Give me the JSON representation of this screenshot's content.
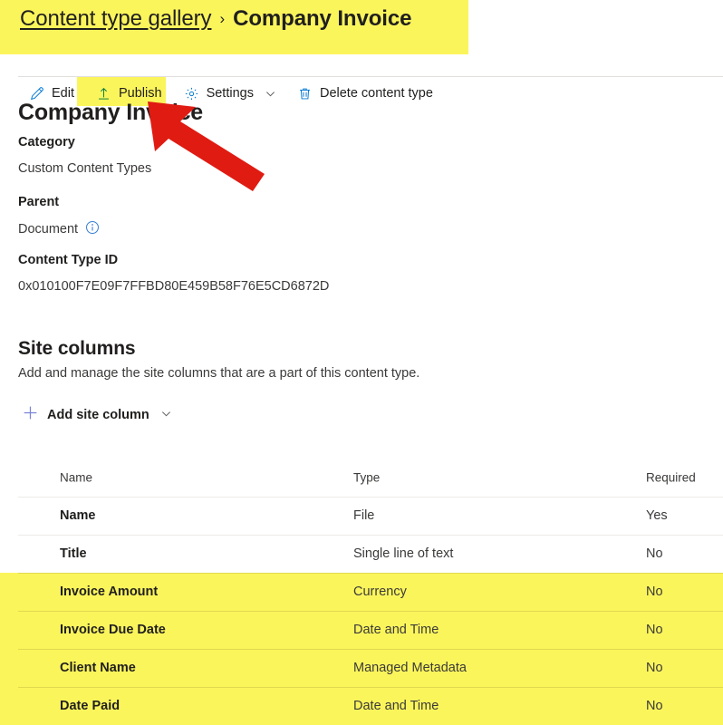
{
  "breadcrumb": {
    "parent_link": "Content type gallery",
    "separator": "›",
    "current": "Company Invoice"
  },
  "toolbar": {
    "edit_label": "Edit",
    "publish_label": "Publish",
    "settings_label": "Settings",
    "delete_label": "Delete content type"
  },
  "details": {
    "title": "Company Invoice",
    "category_label": "Category",
    "category_value": "Custom Content Types",
    "parent_label": "Parent",
    "parent_value": "Document",
    "content_type_id_label": "Content Type ID",
    "content_type_id_value": "0x010100F7E09F7FFBD80E459B58F76E5CD6872D"
  },
  "site_columns": {
    "heading": "Site columns",
    "description": "Add and manage the site columns that are a part of this content type.",
    "add_button_label": "Add site column",
    "headers": {
      "name": "Name",
      "type": "Type",
      "required": "Required"
    },
    "rows": [
      {
        "name": "Name",
        "type": "File",
        "required": "Yes",
        "highlighted": false
      },
      {
        "name": "Title",
        "type": "Single line of text",
        "required": "No",
        "highlighted": false
      },
      {
        "name": "Invoice Amount",
        "type": "Currency",
        "required": "No",
        "highlighted": true
      },
      {
        "name": "Invoice Due Date",
        "type": "Date and Time",
        "required": "No",
        "highlighted": true
      },
      {
        "name": "Client Name",
        "type": "Managed Metadata",
        "required": "No",
        "highlighted": true
      },
      {
        "name": "Date Paid",
        "type": "Date and Time",
        "required": "No",
        "highlighted": true
      }
    ]
  },
  "annotations": {
    "highlight_color": "#fbf55c",
    "arrow_color": "#e01b12",
    "accent_color": "#0078d4"
  }
}
